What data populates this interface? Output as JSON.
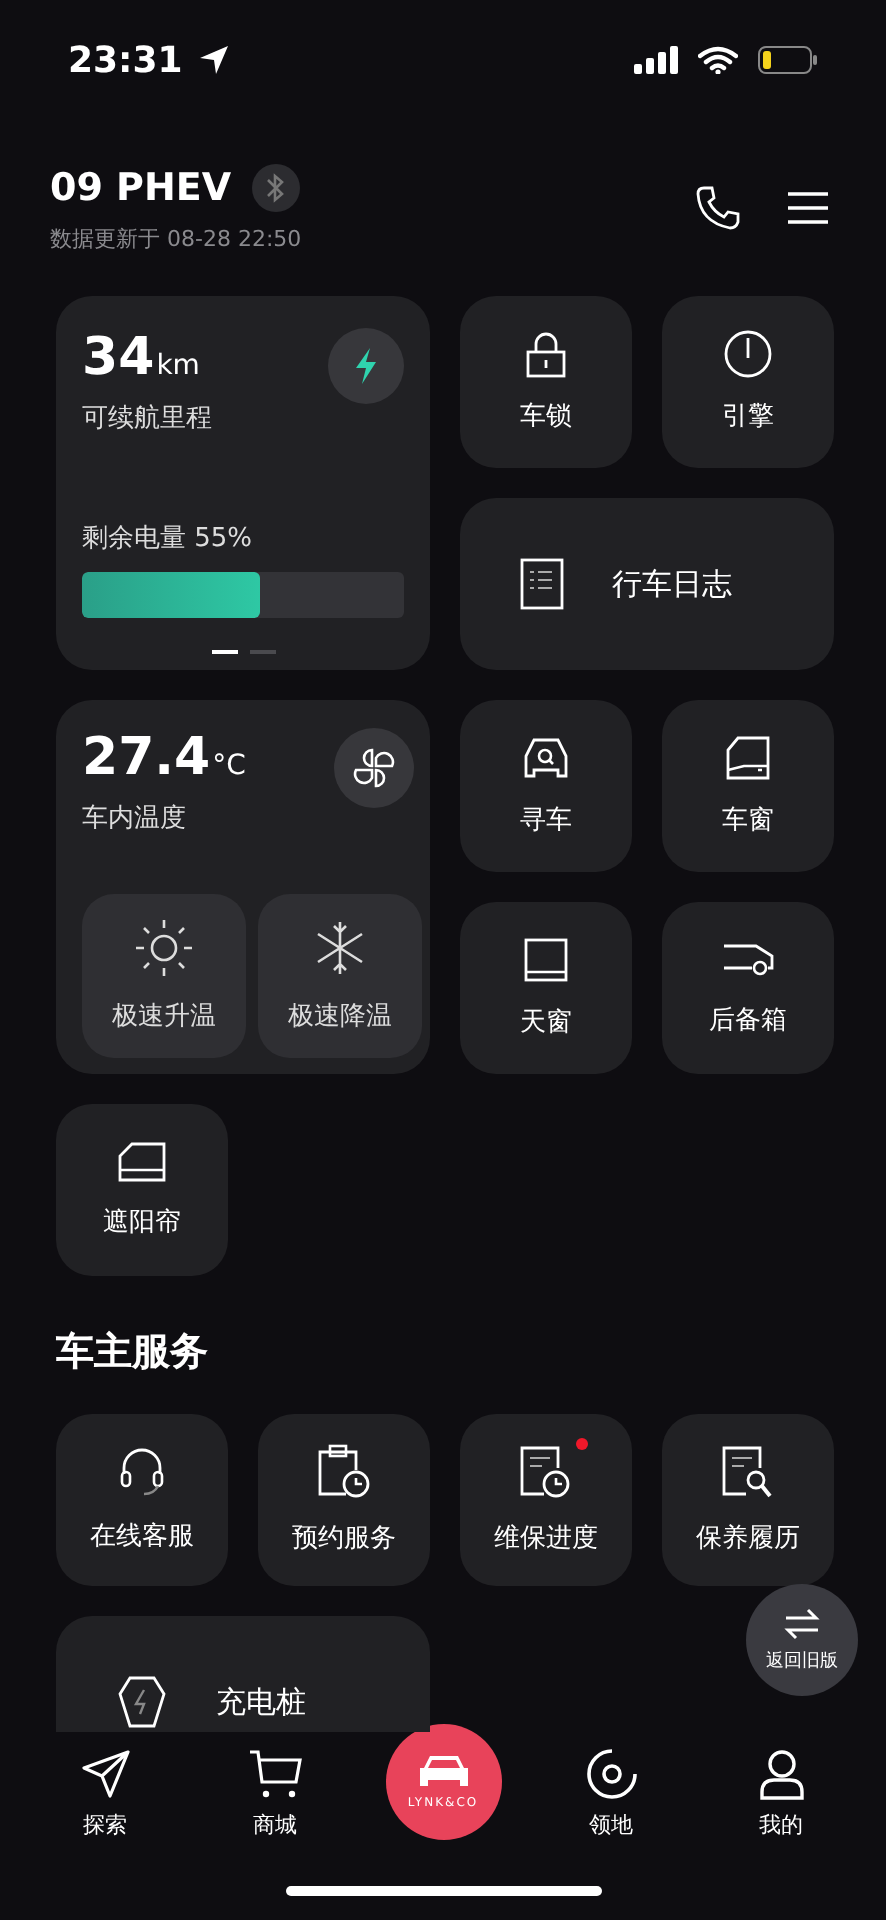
{
  "status_bar": {
    "time": "23:31"
  },
  "header": {
    "title": "09 PHEV",
    "updated": "数据更新于 08-28 22:50"
  },
  "range_card": {
    "value": "34",
    "unit": "km",
    "label": "可续航里程",
    "battery_label": "剩余电量 55%",
    "level": 0.55,
    "pages": [
      {
        "selected": true
      },
      {
        "selected": false
      }
    ]
  },
  "climate_card": {
    "value": "27.4",
    "unit": "°C",
    "label": "车内温度",
    "actions": [
      {
        "label": "极速升温",
        "kind": "heat"
      },
      {
        "label": "极速降温",
        "kind": "cool"
      }
    ]
  },
  "controls": [
    {
      "label": "车锁",
      "kind": "lock"
    },
    {
      "label": "引擎",
      "kind": "engine"
    },
    {
      "label": "行车日志",
      "kind": "log"
    },
    {
      "label": "寻车",
      "kind": "find"
    },
    {
      "label": "车窗",
      "kind": "window"
    },
    {
      "label": "天窗",
      "kind": "sunroof"
    },
    {
      "label": "后备箱",
      "kind": "trunk"
    },
    {
      "label": "遮阳帘",
      "kind": "shade"
    }
  ],
  "services_title": "车主服务",
  "services": [
    {
      "label": "在线客服",
      "kind": "support",
      "badge": false
    },
    {
      "label": "预约服务",
      "kind": "booking",
      "badge": false
    },
    {
      "label": "维保进度",
      "kind": "progress",
      "badge": true
    },
    {
      "label": "保养履历",
      "kind": "history",
      "badge": false
    },
    {
      "label": "充电桩",
      "kind": "charger",
      "badge": false
    }
  ],
  "float_button": {
    "label": "返回旧版"
  },
  "nav": [
    {
      "label": "探索",
      "kind": "explore"
    },
    {
      "label": "商城",
      "kind": "shop"
    },
    {
      "label": "LYNK&CO",
      "kind": "logo"
    },
    {
      "label": "领地",
      "kind": "territory"
    },
    {
      "label": "我的",
      "kind": "me"
    }
  ]
}
